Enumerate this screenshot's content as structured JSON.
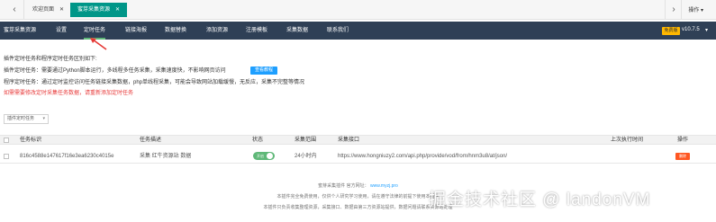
{
  "tabbar": {
    "back_icon": "chevron-left",
    "tabs": [
      {
        "label": "欢迎页面",
        "close": "✕"
      },
      {
        "label": "蜜芽采集资源",
        "close": "✕"
      }
    ],
    "forward_icon": "chevron-right",
    "ops_label": "操作 ▾"
  },
  "menu": {
    "items": [
      "蜜芽采集资源",
      "设置",
      "定时任务",
      "链接海报",
      "数据替换",
      "添加资源",
      "注册模板",
      "采集数据",
      "联系我们"
    ],
    "active_index": 2,
    "version_badge": "免费版",
    "version": "v10.7.5",
    "version_caret": "▾"
  },
  "desc": {
    "line1": "插件定时任务和程序定时任务区别如下:",
    "line2": "插件定时任务：需要通过Python脚本运行，多线程多任务采集，采集速度快，不影响网页访问",
    "button": "查看教程",
    "line3": "程序定时任务：通过定时监控访问任务链接采集数据，php单线程采集，可能会导致网站加载缓慢，无反应，采集不完整等情况",
    "line4": "如需需要修改定时采集任务数据，请重新添加定时任务"
  },
  "filter": {
    "label": "插件定时任务",
    "caret": "▾"
  },
  "table": {
    "headers": [
      "任务标识",
      "任务描述",
      "状态",
      "采集范围",
      "采集接口",
      "上次执行时间",
      "操作"
    ],
    "rows": [
      {
        "id": "816c4588e147617f16e3ea6230c4015e",
        "desc": "采集 红牛资源站 数据",
        "status": "开启",
        "range": "24小时内",
        "api": "https://www.hongniuzy2.com/api.php/provide/vod/from/hnm3u8/at/json/",
        "last_run": "",
        "action": "删除"
      }
    ]
  },
  "footer": {
    "line1_a": "蜜芽采集插件",
    "line1_b": "官方网址：",
    "line1_link": "www.myzj.pro",
    "line2": "本插件完全免费使用，仅供个人研究学习使用，请在遵守法律的前提下使用本插件",
    "line3": "本插件只负责收集整理资源，采集接口、数据由第三方资源站提供，数据问题请联系资源站处理"
  },
  "watermark": "掘金技术社区 @ landonVM",
  "colors": {
    "menu_bg": "#2f4056",
    "active_tab": "#009688",
    "accent_green": "#5fb878",
    "blue": "#1e9fff",
    "red": "#e83b3b",
    "badge": "#ffb800",
    "danger": "#ff5722"
  }
}
